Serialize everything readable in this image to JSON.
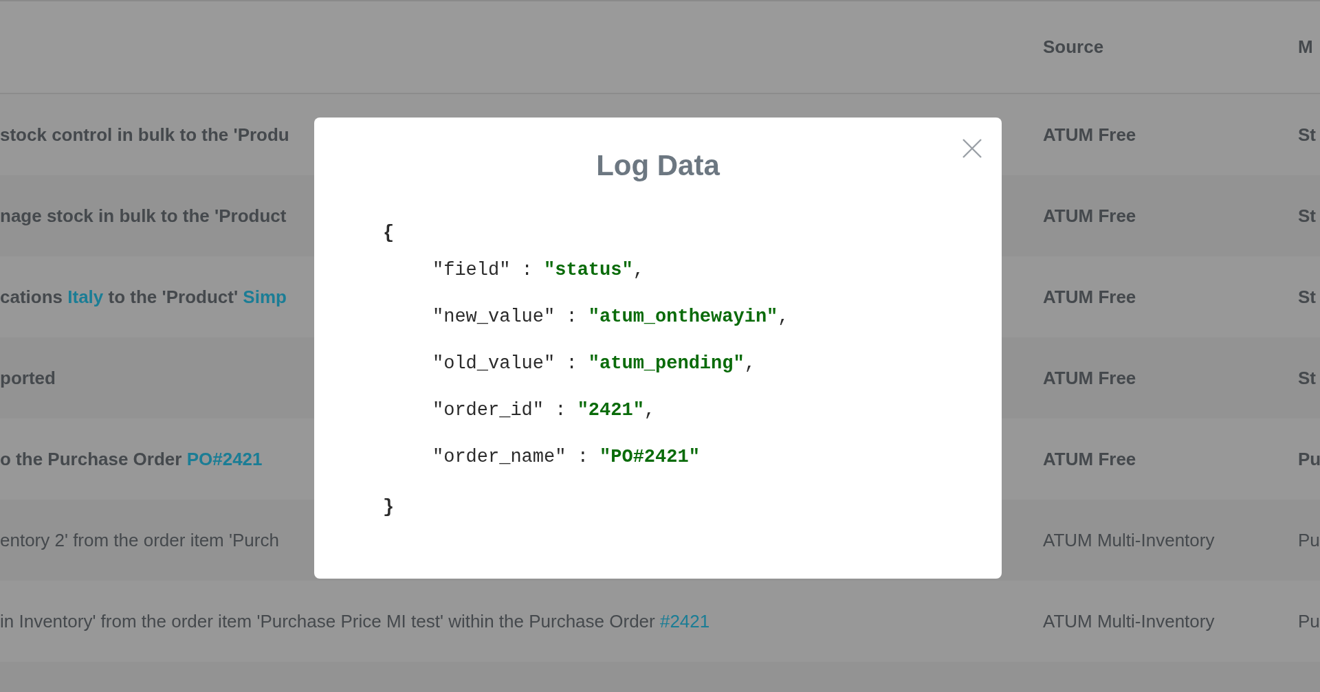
{
  "table": {
    "columns": [
      {
        "label": "Source"
      },
      {
        "label": "M"
      }
    ],
    "rows": [
      {
        "bold": true,
        "message": [
          {
            "text": "stock control in bulk to the 'Produ",
            "link": false
          }
        ],
        "source": "ATUM Free",
        "column_3": "St"
      },
      {
        "bold": true,
        "message": [
          {
            "text": "nage stock in bulk to the 'Product",
            "link": false
          }
        ],
        "source": "ATUM Free",
        "column_3": "St"
      },
      {
        "bold": true,
        "message": [
          {
            "text": "cations ",
            "link": false
          },
          {
            "text": "Italy",
            "link": true
          },
          {
            "text": " to the 'Product' ",
            "link": false
          },
          {
            "text": "Simp",
            "link": true
          }
        ],
        "source": "ATUM Free",
        "column_3": "St"
      },
      {
        "bold": true,
        "message": [
          {
            "text": "ported",
            "link": false
          }
        ],
        "source": "ATUM Free",
        "column_3": "St"
      },
      {
        "bold": true,
        "message": [
          {
            "text": "o the Purchase Order ",
            "link": false
          },
          {
            "text": "PO#2421",
            "link": true
          }
        ],
        "source": "ATUM Free",
        "column_3": "Pu"
      },
      {
        "bold": false,
        "message": [
          {
            "text": "entory 2' from the order item 'Purch",
            "link": false
          }
        ],
        "source": "ATUM Multi-Inventory",
        "column_3": "Pu"
      },
      {
        "bold": false,
        "message": [
          {
            "text": "in Inventory' from the order item 'Purchase Price MI test' within the Purchase Order ",
            "link": false
          },
          {
            "text": "#2421",
            "link": true
          }
        ],
        "source": "ATUM Multi-Inventory",
        "column_3": "Pu"
      }
    ]
  },
  "modal": {
    "title": "Log Data",
    "open_brace": "{",
    "close_brace": "}",
    "entries": [
      {
        "key": "\"field\"",
        "colon": ":",
        "value": "\"status\"",
        "trailing": ","
      },
      {
        "key": "\"new_value\"",
        "colon": ":",
        "value": "\"atum_onthewayin\"",
        "trailing": ","
      },
      {
        "key": "\"old_value\"",
        "colon": ":",
        "value": "\"atum_pending\"",
        "trailing": ","
      },
      {
        "key": "\"order_id\"",
        "colon": ":",
        "value": "\"2421\"",
        "trailing": ","
      },
      {
        "key": "\"order_name\"",
        "colon": ":",
        "value": "\"PO#2421\""
      }
    ]
  }
}
